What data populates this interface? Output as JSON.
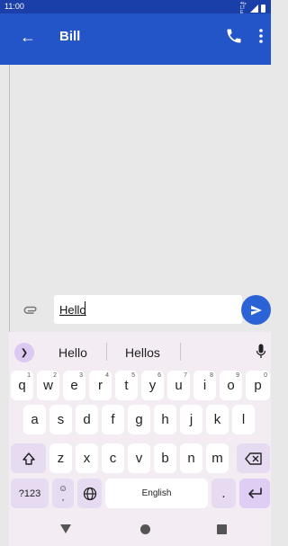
{
  "status_bar": {
    "time": "11:00",
    "network": "4G LTE"
  },
  "app_bar": {
    "title": "Bill"
  },
  "compose": {
    "input_value": "Hello"
  },
  "suggestions": [
    "Hello",
    "Hellos"
  ],
  "keyboard": {
    "row1": [
      {
        "k": "q",
        "s": "1"
      },
      {
        "k": "w",
        "s": "2"
      },
      {
        "k": "e",
        "s": "3"
      },
      {
        "k": "r",
        "s": "4"
      },
      {
        "k": "t",
        "s": "5"
      },
      {
        "k": "y",
        "s": "6"
      },
      {
        "k": "u",
        "s": "7"
      },
      {
        "k": "i",
        "s": "8"
      },
      {
        "k": "o",
        "s": "9"
      },
      {
        "k": "p",
        "s": "0"
      }
    ],
    "row2": [
      "a",
      "s",
      "d",
      "f",
      "g",
      "h",
      "j",
      "k",
      "l"
    ],
    "row3": [
      "z",
      "x",
      "c",
      "v",
      "b",
      "n",
      "m"
    ],
    "symbols_label": "?123",
    "comma_label": ",",
    "space_label": "English",
    "period_label": "."
  },
  "icons": {
    "back": "arrow-left",
    "call": "phone",
    "more": "more-vertical",
    "attach": "paperclip",
    "send": "send",
    "mic": "microphone",
    "shift": "shift-arrow",
    "backspace": "backspace",
    "globe": "globe",
    "enter": "enter-arrow",
    "emoji": "emoji"
  },
  "colors": {
    "app_bar": "#2355c8",
    "status_bar": "#1a3fa8",
    "send": "#2b63d6",
    "keyboard": "#f3ecf3"
  }
}
